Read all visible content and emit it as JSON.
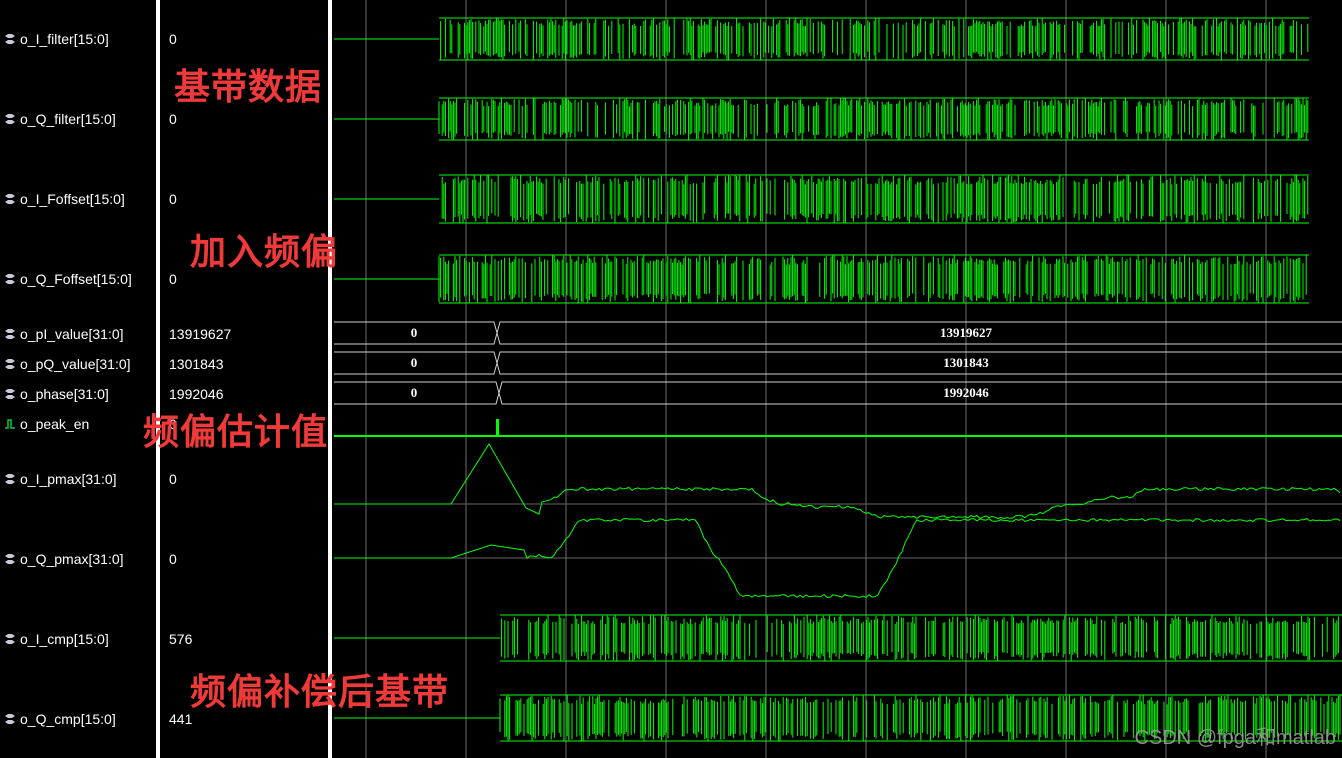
{
  "signals": [
    {
      "name": "o_I_filter[15:0]",
      "value": "0",
      "icon": "bus-icon",
      "kind": "dense"
    },
    {
      "name": "o_Q_filter[15:0]",
      "value": "0",
      "icon": "bus-icon",
      "kind": "dense"
    },
    {
      "name": "o_I_Foffset[15:0]",
      "value": "0",
      "icon": "bus-icon",
      "kind": "dense"
    },
    {
      "name": "o_Q_Foffset[15:0]",
      "value": "0",
      "icon": "bus-icon",
      "kind": "dense"
    },
    {
      "name": "o_pI_value[31:0]",
      "value": "13919627",
      "icon": "bus-icon",
      "kind": "bus",
      "bus_values": [
        "0",
        "13919627"
      ]
    },
    {
      "name": "o_pQ_value[31:0]",
      "value": "1301843",
      "icon": "bus-icon",
      "kind": "bus",
      "bus_values": [
        "0",
        "1301843"
      ]
    },
    {
      "name": "o_phase[31:0]",
      "value": "1992046",
      "icon": "bus-icon",
      "kind": "bus",
      "bus_values": [
        "0",
        "1992046"
      ]
    },
    {
      "name": "o_peak_en",
      "value": "0",
      "icon": "bit-icon",
      "kind": "bit"
    },
    {
      "name": "o_I_pmax[31:0]",
      "value": "0",
      "icon": "bus-icon",
      "kind": "analog"
    },
    {
      "name": "o_Q_pmax[31:0]",
      "value": "0",
      "icon": "bus-icon",
      "kind": "analog"
    },
    {
      "name": "o_I_cmp[15:0]",
      "value": "576",
      "icon": "bus-icon",
      "kind": "dense"
    },
    {
      "name": "o_Q_cmp[15:0]",
      "value": "441",
      "icon": "bus-icon",
      "kind": "dense"
    }
  ],
  "annotations": [
    {
      "text": "基带数据"
    },
    {
      "text": "加入频偏"
    },
    {
      "text": "频偏估计值"
    },
    {
      "text": "频偏补偿后基带"
    }
  ],
  "watermark": "CSDN @fpga和matlab",
  "colors": {
    "background": "#000000",
    "wave": "#00ff00",
    "grid": "#6e6e6e",
    "annotation": "#f03a3a"
  }
}
